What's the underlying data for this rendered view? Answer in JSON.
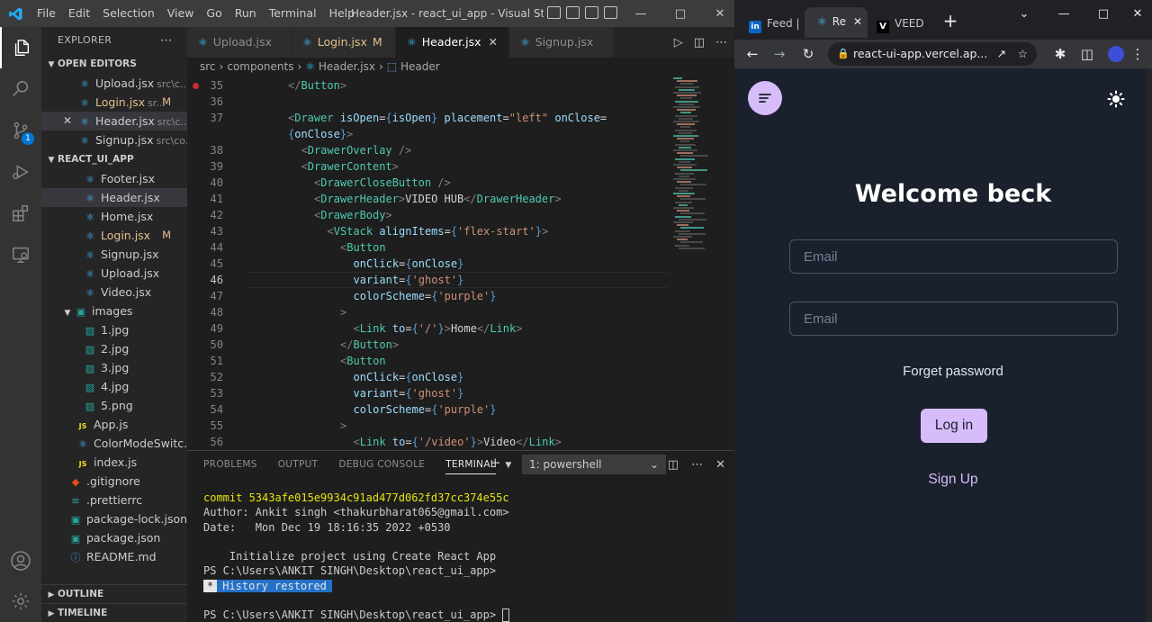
{
  "vscode": {
    "menu": [
      "File",
      "Edit",
      "Selection",
      "View",
      "Go",
      "Run",
      "Terminal",
      "Help"
    ],
    "window_title": "Header.jsx - react_ui_app - Visual Studio ...",
    "explorer_title": "EXPLORER",
    "open_editors_title": "OPEN EDITORS",
    "open_editors": [
      {
        "name": "Upload.jsx",
        "desc": "src\\c...",
        "modified": false
      },
      {
        "name": "Login.jsx",
        "desc": "sr...",
        "modified": true
      },
      {
        "name": "Header.jsx",
        "desc": "src\\c...",
        "modified": false
      },
      {
        "name": "Signup.jsx",
        "desc": "src\\co...",
        "modified": false
      }
    ],
    "project_title": "REACT_UI_APP",
    "components_files": [
      "Footer.jsx",
      "Header.jsx",
      "Home.jsx",
      "Login.jsx",
      "Signup.jsx",
      "Upload.jsx",
      "Video.jsx"
    ],
    "images_folder": "images",
    "image_files": [
      "1.jpg",
      "2.jpg",
      "3.jpg",
      "4.jpg",
      "5.png"
    ],
    "root_files": [
      "App.js",
      "ColorModeSwitc...",
      "index.js",
      ".gitignore",
      ".prettierrc",
      "package-lock.json",
      "package.json",
      "README.md"
    ],
    "modified_marker": "M",
    "badge_count": "1",
    "outline_title": "OUTLINE",
    "timeline_title": "TIMELINE",
    "tabs": [
      {
        "label": "Upload.jsx",
        "modified": false,
        "active": false
      },
      {
        "label": "Login.jsx",
        "modified": true,
        "active": false
      },
      {
        "label": "Header.jsx",
        "modified": false,
        "active": true
      },
      {
        "label": "Signup.jsx",
        "modified": false,
        "active": false
      }
    ],
    "breadcrumb": [
      "src",
      "components",
      "Header.jsx",
      "Header"
    ],
    "code_lines": [
      {
        "n": "35",
        "tokens": [
          [
            "br",
            "</"
          ],
          [
            "tag",
            "Button"
          ],
          [
            "br",
            ">"
          ]
        ],
        "indent": 0
      },
      {
        "n": "36",
        "tokens": [],
        "indent": 0
      },
      {
        "n": "37",
        "tokens": [
          [
            "br",
            "<"
          ],
          [
            "tag",
            "Drawer"
          ],
          [
            "plain",
            " "
          ],
          [
            "attr",
            "isOpen"
          ],
          [
            "plain",
            "="
          ],
          [
            "brace",
            "{"
          ],
          [
            "attr",
            "isOpen"
          ],
          [
            "brace",
            "}"
          ],
          [
            "plain",
            " "
          ],
          [
            "attr",
            "placement"
          ],
          [
            "plain",
            "="
          ],
          [
            "str",
            "\"left\""
          ],
          [
            "plain",
            " "
          ],
          [
            "attr",
            "onClose"
          ],
          [
            "plain",
            "="
          ]
        ],
        "indent": 0
      },
      {
        "n": "",
        "tokens": [
          [
            "brace",
            "{"
          ],
          [
            "attr",
            "onClose"
          ],
          [
            "brace",
            "}"
          ],
          [
            "br",
            ">"
          ]
        ],
        "indent": 0
      },
      {
        "n": "38",
        "tokens": [
          [
            "br",
            "<"
          ],
          [
            "tag",
            "DrawerOverlay"
          ],
          [
            "plain",
            " "
          ],
          [
            "br",
            "/>"
          ]
        ],
        "indent": 1
      },
      {
        "n": "39",
        "tokens": [
          [
            "br",
            "<"
          ],
          [
            "tag",
            "DrawerContent"
          ],
          [
            "br",
            ">"
          ]
        ],
        "indent": 1
      },
      {
        "n": "40",
        "tokens": [
          [
            "br",
            "<"
          ],
          [
            "tag",
            "DrawerCloseButton"
          ],
          [
            "plain",
            " "
          ],
          [
            "br",
            "/>"
          ]
        ],
        "indent": 2
      },
      {
        "n": "41",
        "tokens": [
          [
            "br",
            "<"
          ],
          [
            "tag",
            "DrawerHeader"
          ],
          [
            "br",
            ">"
          ],
          [
            "plain",
            "VIDEO HUB"
          ],
          [
            "br",
            "</"
          ],
          [
            "tag",
            "DrawerHeader"
          ],
          [
            "br",
            ">"
          ]
        ],
        "indent": 2
      },
      {
        "n": "42",
        "tokens": [
          [
            "br",
            "<"
          ],
          [
            "tag",
            "DrawerBody"
          ],
          [
            "br",
            ">"
          ]
        ],
        "indent": 2
      },
      {
        "n": "43",
        "tokens": [
          [
            "br",
            "<"
          ],
          [
            "tag",
            "VStack"
          ],
          [
            "plain",
            " "
          ],
          [
            "attr",
            "alignItems"
          ],
          [
            "plain",
            "="
          ],
          [
            "brace",
            "{"
          ],
          [
            "str",
            "'flex-start'"
          ],
          [
            "brace",
            "}"
          ],
          [
            "br",
            ">"
          ]
        ],
        "indent": 3
      },
      {
        "n": "44",
        "tokens": [
          [
            "br",
            "<"
          ],
          [
            "tag",
            "Button"
          ]
        ],
        "indent": 4
      },
      {
        "n": "45",
        "tokens": [
          [
            "attr",
            "onClick"
          ],
          [
            "plain",
            "="
          ],
          [
            "brace",
            "{"
          ],
          [
            "attr",
            "onClose"
          ],
          [
            "brace",
            "}"
          ]
        ],
        "indent": 5
      },
      {
        "n": "46",
        "tokens": [
          [
            "attr",
            "variant"
          ],
          [
            "plain",
            "="
          ],
          [
            "brace",
            "{"
          ],
          [
            "str",
            "'ghost'"
          ],
          [
            "brace",
            "}"
          ]
        ],
        "indent": 5
      },
      {
        "n": "47",
        "tokens": [
          [
            "attr",
            "colorScheme"
          ],
          [
            "plain",
            "="
          ],
          [
            "brace",
            "{"
          ],
          [
            "str",
            "'purple'"
          ],
          [
            "brace",
            "}"
          ]
        ],
        "indent": 5
      },
      {
        "n": "48",
        "tokens": [
          [
            "br",
            ">"
          ]
        ],
        "indent": 4
      },
      {
        "n": "49",
        "tokens": [
          [
            "br",
            "<"
          ],
          [
            "tag",
            "Link"
          ],
          [
            "plain",
            " "
          ],
          [
            "attr",
            "to"
          ],
          [
            "plain",
            "="
          ],
          [
            "brace",
            "{"
          ],
          [
            "str",
            "'/'"
          ],
          [
            "brace",
            "}"
          ],
          [
            "br",
            ">"
          ],
          [
            "plain",
            "Home"
          ],
          [
            "br",
            "</"
          ],
          [
            "tag",
            "Link"
          ],
          [
            "br",
            ">"
          ]
        ],
        "indent": 5
      },
      {
        "n": "50",
        "tokens": [
          [
            "br",
            "</"
          ],
          [
            "tag",
            "Button"
          ],
          [
            "br",
            ">"
          ]
        ],
        "indent": 4
      },
      {
        "n": "51",
        "tokens": [
          [
            "br",
            "<"
          ],
          [
            "tag",
            "Button"
          ]
        ],
        "indent": 4
      },
      {
        "n": "52",
        "tokens": [
          [
            "attr",
            "onClick"
          ],
          [
            "plain",
            "="
          ],
          [
            "brace",
            "{"
          ],
          [
            "attr",
            "onClose"
          ],
          [
            "brace",
            "}"
          ]
        ],
        "indent": 5
      },
      {
        "n": "53",
        "tokens": [
          [
            "attr",
            "variant"
          ],
          [
            "plain",
            "="
          ],
          [
            "brace",
            "{"
          ],
          [
            "str",
            "'ghost'"
          ],
          [
            "brace",
            "}"
          ]
        ],
        "indent": 5
      },
      {
        "n": "54",
        "tokens": [
          [
            "attr",
            "colorScheme"
          ],
          [
            "plain",
            "="
          ],
          [
            "brace",
            "{"
          ],
          [
            "str",
            "'purple'"
          ],
          [
            "brace",
            "}"
          ]
        ],
        "indent": 5
      },
      {
        "n": "55",
        "tokens": [
          [
            "br",
            ">"
          ]
        ],
        "indent": 4
      },
      {
        "n": "56",
        "tokens": [
          [
            "br",
            "<"
          ],
          [
            "tag",
            "Link"
          ],
          [
            "plain",
            " "
          ],
          [
            "attr",
            "to"
          ],
          [
            "plain",
            "="
          ],
          [
            "brace",
            "{"
          ],
          [
            "str",
            "'/video'"
          ],
          [
            "brace",
            "}"
          ],
          [
            "br",
            ">"
          ],
          [
            "plain",
            "Video"
          ],
          [
            "br",
            "</"
          ],
          [
            "tag",
            "Link"
          ],
          [
            "br",
            ">"
          ]
        ],
        "indent": 5
      }
    ],
    "current_line": "46",
    "panel_tabs": [
      "PROBLEMS",
      "OUTPUT",
      "DEBUG CONSOLE",
      "TERMINAL"
    ],
    "terminal_select": "1: powershell",
    "terminal_lines": {
      "commit": "commit 5343afe015e9934c91ad477d062fd37cc374e55c",
      "author": "Author: Ankit singh <thakurbharat065@gmail.com>",
      "date": "Date:   Mon Dec 19 18:16:35 2022 +0530",
      "message": "    Initialize project using Create React App",
      "prompt1": "PS C:\\Users\\ANKIT SINGH\\Desktop\\react_ui_app>",
      "hist_star": "*",
      "hist_text": "History restored",
      "prompt2": "PS C:\\Users\\ANKIT SINGH\\Desktop\\react_ui_app>"
    }
  },
  "chrome": {
    "tabs": [
      {
        "label": "Feed |",
        "icon": "linkedin-icon"
      },
      {
        "label": "Re",
        "icon": "react-icon"
      },
      {
        "label": "VEED",
        "icon": "veed-icon"
      }
    ],
    "url": "react-ui-app.vercel.ap...",
    "page": {
      "title": "Welcome beck",
      "email_placeholder_1": "Email",
      "email_placeholder_2": "Email",
      "forget": "Forget password",
      "login": "Log in",
      "signup": "Sign Up"
    }
  },
  "colors": {
    "vscode_accent": "#0078d4",
    "brand_purple": "#d6bcfa",
    "page_bg": "#1a202c"
  }
}
